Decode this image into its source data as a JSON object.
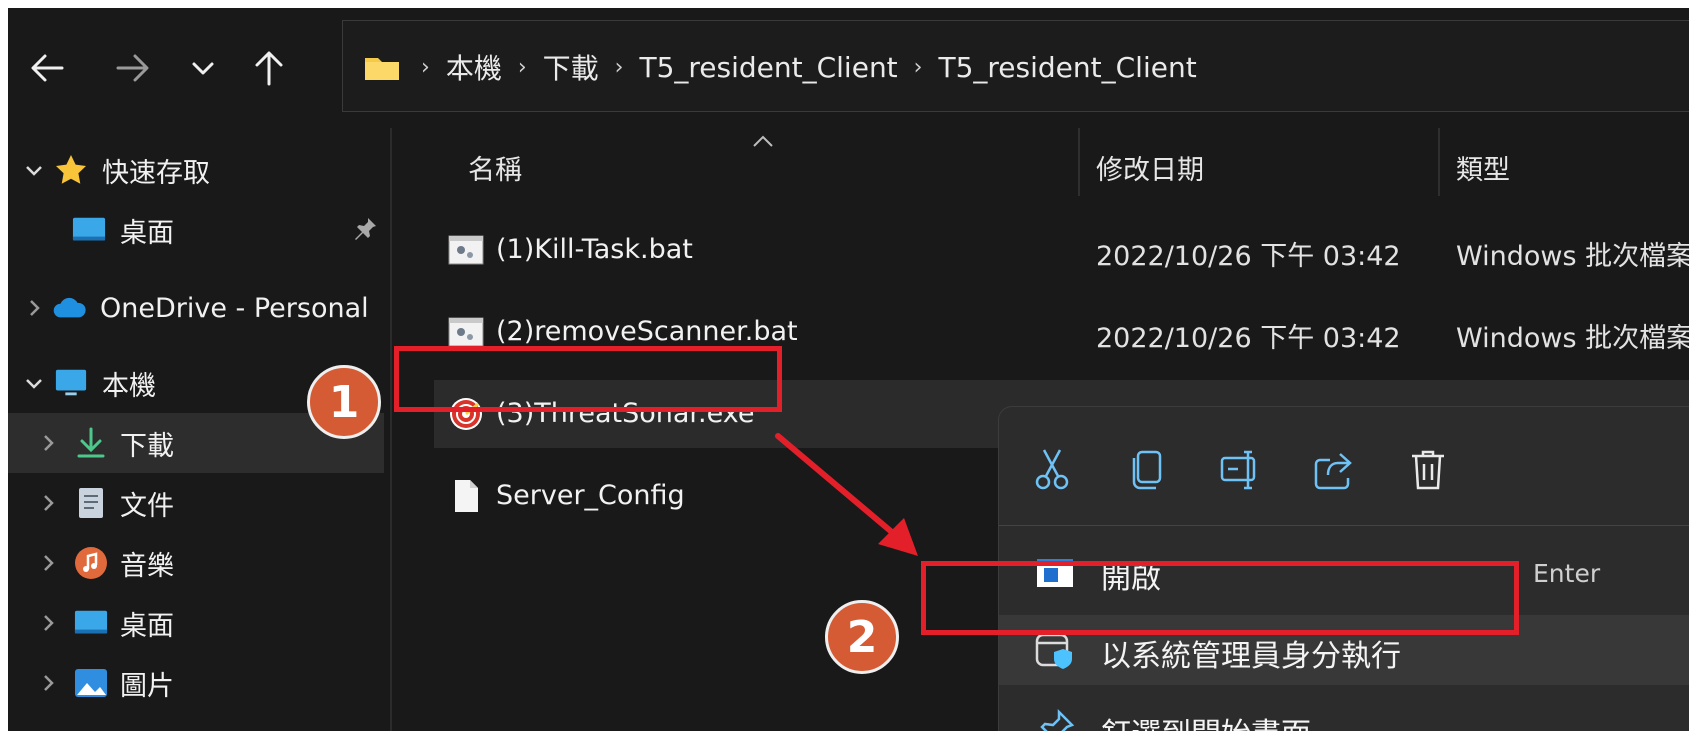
{
  "nav": {
    "back": "back",
    "forward": "forward",
    "recent": "recent",
    "up": "up"
  },
  "address": {
    "segments": [
      "本機",
      "下載",
      "T5_resident_Client",
      "T5_resident_Client"
    ],
    "separator": "›"
  },
  "sidebar": {
    "items": [
      {
        "label": "快速存取",
        "icon": "star-icon",
        "expanded": true
      },
      {
        "label": "桌面",
        "icon": "desktop-icon",
        "pinned": true
      },
      {
        "label": "OneDrive - Personal",
        "icon": "cloud-icon",
        "expanded": false
      },
      {
        "label": "本機",
        "icon": "computer-icon",
        "expanded": true
      },
      {
        "label": "下載",
        "icon": "download-icon",
        "selected": true
      },
      {
        "label": "文件",
        "icon": "document-icon"
      },
      {
        "label": "音樂",
        "icon": "music-icon"
      },
      {
        "label": "桌面",
        "icon": "desktop-icon"
      },
      {
        "label": "圖片",
        "icon": "pictures-icon"
      }
    ]
  },
  "columns": {
    "name": "名稱",
    "modified": "修改日期",
    "type": "類型"
  },
  "files": [
    {
      "name": "(1)Kill-Task.bat",
      "modified": "2022/10/26 下午 03:42",
      "type": "Windows 批次檔案",
      "icon": "batch-file-icon"
    },
    {
      "name": "(2)removeScanner.bat",
      "modified": "2022/10/26 下午 03:42",
      "type": "Windows 批次檔案",
      "icon": "batch-file-icon"
    },
    {
      "name": "(3)ThreatSonar.exe",
      "modified": "",
      "type": "",
      "icon": "threatsonar-app-icon"
    },
    {
      "name": "Server_Config",
      "modified": "",
      "type": "",
      "icon": "file-icon"
    }
  ],
  "annotations": {
    "step1": "1",
    "step2": "2"
  },
  "context_menu": {
    "toolbar": [
      "cut-icon",
      "copy-icon",
      "rename-icon",
      "share-icon",
      "delete-icon"
    ],
    "items": [
      {
        "label": "開啟",
        "shortcut": "Enter",
        "icon": "open-icon"
      },
      {
        "label": "以系統管理員身分執行",
        "shortcut": "",
        "icon": "admin-shield-icon",
        "highlighted": true
      },
      {
        "label": "釘選到開始畫面",
        "shortcut": "",
        "icon": "pin-icon"
      }
    ]
  },
  "colors": {
    "background": "#191919",
    "annotation_red": "#e3202a",
    "badge_orange": "#d45b34",
    "accent_blue": "#4cc2ff"
  }
}
